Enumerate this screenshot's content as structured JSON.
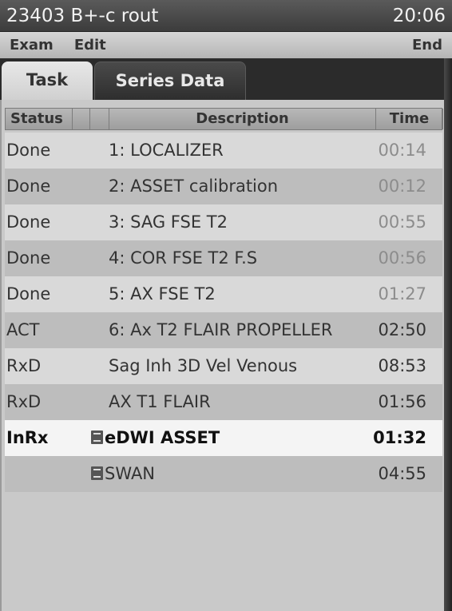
{
  "titlebar": {
    "title": "23403 B+-c rout",
    "clock": "20:06"
  },
  "menu": {
    "exam": "Exam",
    "edit": "Edit",
    "end": "End"
  },
  "tabs": {
    "task": "Task",
    "series": "Series Data"
  },
  "table": {
    "headers": {
      "status": "Status",
      "description": "Description",
      "time": "Time"
    },
    "rows": [
      {
        "status": "Done",
        "description": "1: LOCALIZER",
        "time": "00:14"
      },
      {
        "status": "Done",
        "description": "2: ASSET calibration",
        "time": "00:12"
      },
      {
        "status": "Done",
        "description": "3: SAG FSE T2",
        "time": "00:55"
      },
      {
        "status": "Done",
        "description": "4: COR FSE T2 F.S",
        "time": "00:56"
      },
      {
        "status": "Done",
        "description": "5: AX FSE T2",
        "time": "01:27"
      },
      {
        "status": "ACT",
        "description": "6: Ax T2 FLAIR PROPELLER",
        "time": "02:50"
      },
      {
        "status": "RxD",
        "description": "Sag Inh 3D Vel Venous",
        "time": "08:53"
      },
      {
        "status": "RxD",
        "description": "AX T1 FLAIR",
        "time": "01:56"
      },
      {
        "status": "InRx",
        "description": "eDWI ASSET",
        "time": "01:32",
        "icon": "document-icon"
      },
      {
        "status": "",
        "description": "SWAN",
        "time": "04:55",
        "icon": "document-icon"
      }
    ]
  },
  "colors": {
    "titlebar": "#4a4a4a",
    "selected_row": "#f4f4f4",
    "dim_time": "#8c8c8c"
  }
}
